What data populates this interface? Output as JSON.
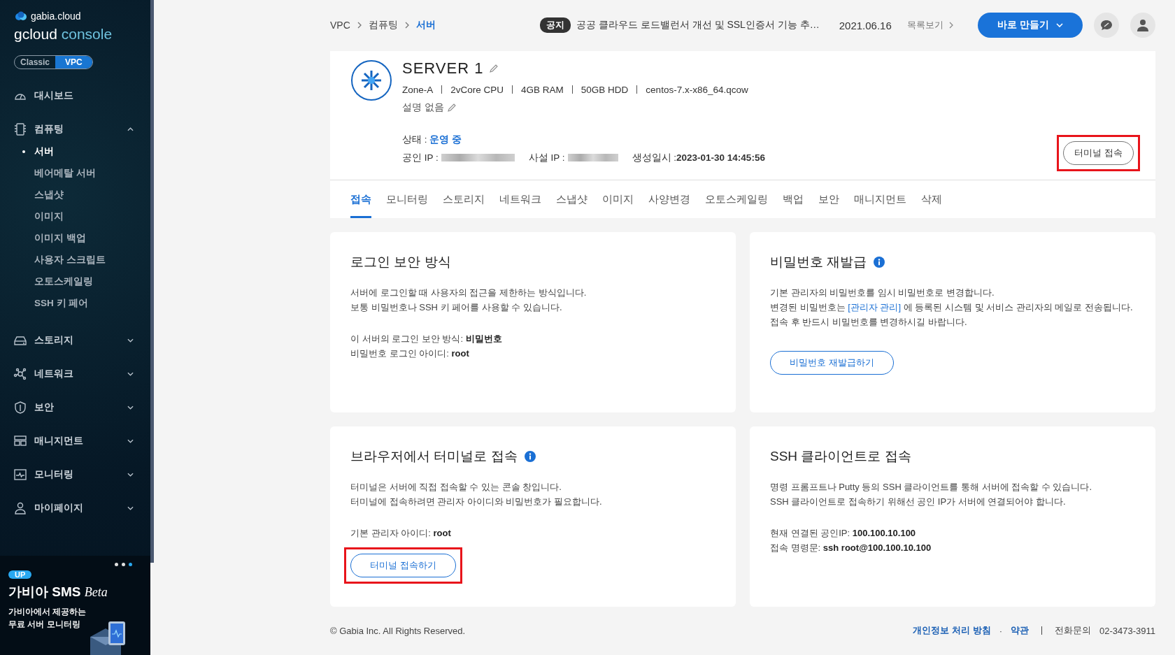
{
  "sidebar": {
    "brand": {
      "company": "gabia.cloud",
      "product": "gcloud",
      "product_suffix": "console"
    },
    "mode_toggle": [
      {
        "label": "Classic",
        "selected": false
      },
      {
        "label": "VPC",
        "selected": true
      }
    ],
    "menu": [
      {
        "label": "대시보드",
        "kind": "dashboard"
      },
      {
        "label": "컴퓨팅",
        "kind": "compute",
        "expanded": true,
        "children": [
          {
            "label": "서버",
            "selected": true
          },
          {
            "label": "베어메탈 서버",
            "selected": false
          },
          {
            "label": "스냅샷",
            "selected": false
          },
          {
            "label": "이미지",
            "selected": false
          },
          {
            "label": "이미지 백업",
            "selected": false
          },
          {
            "label": "사용자 스크립트",
            "selected": false
          },
          {
            "label": "오토스케일링",
            "selected": false
          },
          {
            "label": "SSH 키 페어",
            "selected": false
          }
        ]
      },
      {
        "label": "스토리지",
        "kind": "storage",
        "expanded": false
      },
      {
        "label": "네트워크",
        "kind": "network",
        "expanded": false
      },
      {
        "label": "보안",
        "kind": "security",
        "expanded": false
      },
      {
        "label": "매니지먼트",
        "kind": "management",
        "expanded": false
      },
      {
        "label": "모니터링",
        "kind": "monitoring",
        "expanded": false
      },
      {
        "label": "마이페이지",
        "kind": "user",
        "expanded": false
      }
    ],
    "banner": {
      "badge": "UP",
      "title": "가비아 SMS",
      "title_suffix": "Beta",
      "lines": [
        "가비아에서 제공하는",
        "무료 서버 모니터링"
      ],
      "dots": [
        {
          "selected": false
        },
        {
          "selected": false
        },
        {
          "selected": true
        }
      ]
    }
  },
  "header": {
    "breadcrumb": [
      {
        "label": "VPC",
        "selected": false
      },
      {
        "label": "컴퓨팅",
        "selected": false
      },
      {
        "label": "서버",
        "selected": true
      }
    ],
    "notice": {
      "tag": "공지",
      "text": "공공 클라우드 로드밸런서 개선 및 SSL인증서 기능 추…",
      "date": "2021.06.16",
      "more": "목록보기"
    },
    "create_button": "바로 만들기"
  },
  "server": {
    "name": "SERVER 1",
    "specs": [
      "Zone-A",
      "2vCore CPU",
      "4GB RAM",
      "50GB HDD",
      "centos-7.x-x86_64.qcow"
    ],
    "description": "설명 없음",
    "status_label": "상태 :",
    "status": "운영 중",
    "public_ip_label": "공인 IP :",
    "private_ip_label": "사설 IP :",
    "created_label": "생성일시 :",
    "created": "2023-01-30 14:45:56",
    "terminal_button": {
      "label": "터미널 접속",
      "highlighted": true
    }
  },
  "tabs": [
    {
      "label": "접속",
      "selected": true
    },
    {
      "label": "모니터링",
      "selected": false
    },
    {
      "label": "스토리지",
      "selected": false
    },
    {
      "label": "네트워크",
      "selected": false
    },
    {
      "label": "스냅샷",
      "selected": false
    },
    {
      "label": "이미지",
      "selected": false
    },
    {
      "label": "사양변경",
      "selected": false
    },
    {
      "label": "오토스케일링",
      "selected": false
    },
    {
      "label": "백업",
      "selected": false
    },
    {
      "label": "보안",
      "selected": false
    },
    {
      "label": "매니지먼트",
      "selected": false
    },
    {
      "label": "삭제",
      "selected": false
    }
  ],
  "cards": [
    {
      "title": "로그인 보안 방식",
      "info": false,
      "paragraphs": [
        [
          {
            "text": "서버에 로그인할 때 사용자의 접근을 제한하는 방식입니다.",
            "kind": "plain"
          }
        ],
        [
          {
            "text": "보통 비밀번호나 SSH 키 페어를 사용할 수 있습니다.",
            "kind": "plain"
          }
        ]
      ],
      "details": [
        "이 서버의 로그인 보안 방식: **비밀번호**",
        "비밀번호 로그인 아이디: **root**"
      ]
    },
    {
      "title": "비밀번호 재발급",
      "info": true,
      "paragraphs": [
        [
          {
            "text": "기본 관리자의 비밀번호를 임시 비밀번호로 변경합니다.",
            "kind": "plain"
          }
        ],
        [
          {
            "text": "변경된 비밀번호는 ",
            "kind": "plain"
          },
          {
            "text": "[관리자 관리]",
            "kind": "link"
          },
          {
            "text": " 에 등록된 시스템 및 서비스 관리자의 메일로 전송됩니다.",
            "kind": "plain"
          }
        ],
        [
          {
            "text": "접속 후 반드시 비밀번호를 변경하시길 바랍니다.",
            "kind": "plain"
          }
        ]
      ],
      "button": {
        "label": "비밀번호 재발급하기",
        "highlighted": false
      }
    },
    {
      "title": "브라우저에서 터미널로 접속",
      "info": true,
      "paragraphs": [
        [
          {
            "text": "터미널은 서버에 직접 접속할 수 있는 콘솔 창입니다.",
            "kind": "plain"
          }
        ],
        [
          {
            "text": "터미널에 접속하려면 관리자 아이디와 비밀번호가 필요합니다.",
            "kind": "plain"
          }
        ]
      ],
      "details": [
        "기본 관리자 아이디: **root**"
      ],
      "button": {
        "label": "터미널 접속하기",
        "highlighted": true
      }
    },
    {
      "title": "SSH 클라이언트로 접속",
      "info": false,
      "paragraphs": [
        [
          {
            "text": "명령 프롬프트나 Putty 등의 SSH 클라이언트를 통해 서버에 접속할 수 있습니다.",
            "kind": "plain"
          }
        ],
        [
          {
            "text": "SSH 클라이언트로 접속하기 위해선 공인 IP가 서버에 연결되어야 합니다.",
            "kind": "plain"
          }
        ]
      ],
      "details": [
        "현재 연결된 공인IP: **100.100.10.100**",
        "접속 명령문: **ssh root@100.100.10.100**"
      ]
    }
  ],
  "footer": {
    "copyright": "© Gabia Inc. All Rights Reserved.",
    "links": [
      "개인정보 처리 방침",
      "약관"
    ],
    "separator": "·",
    "phone_label": "전화문의",
    "phone": "02-3473-3911"
  }
}
